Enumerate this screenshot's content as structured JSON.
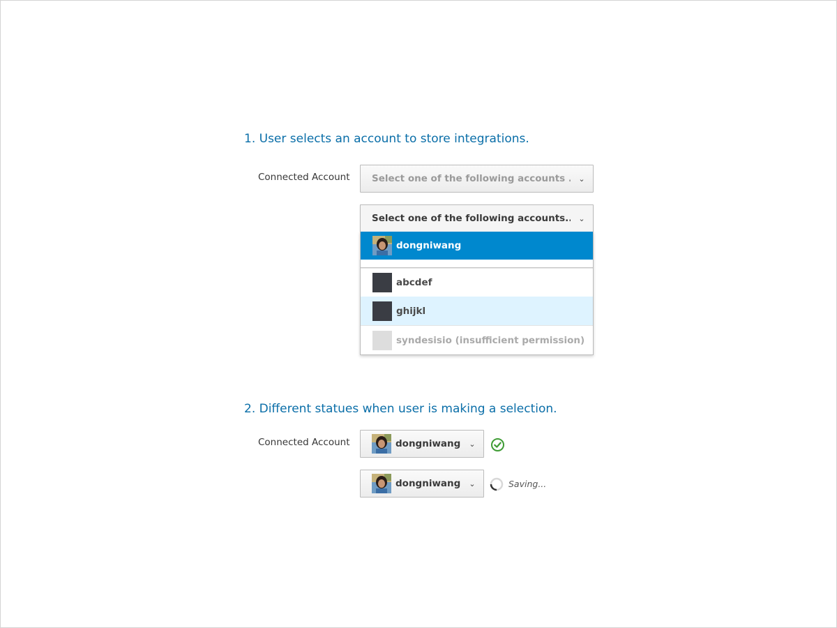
{
  "section1": {
    "heading": "1. User selects an account to store integrations.",
    "label": "Connected Account",
    "closed_select": {
      "placeholder": "Select one of the following accounts ...",
      "caret": "⌄"
    },
    "open_select": {
      "placeholder": "Select one of the following accounts...",
      "caret": "⌄"
    },
    "menu": {
      "items": [
        {
          "name": "dongniwang",
          "state": "selected",
          "avatar": "photo"
        },
        {
          "name": "abcdef",
          "state": "normal",
          "avatar": "dark"
        },
        {
          "name": "ghijkl",
          "state": "hover",
          "avatar": "dark"
        },
        {
          "name": "syndesisio (insufficient permission)",
          "state": "disabled",
          "avatar": "light"
        }
      ]
    }
  },
  "section2": {
    "heading": "2. Different statues when user is making a selection.",
    "label": "Connected Account",
    "saved_select": {
      "value": "dongniwang",
      "caret": "⌄"
    },
    "saving_select": {
      "value": "dongniwang",
      "caret": "⌄"
    },
    "saving_text": "Saving..."
  },
  "colors": {
    "heading": "#0a6ea8",
    "selected_bg": "#0088ce",
    "hover_bg": "#def3ff",
    "success": "#3f9c35"
  },
  "icons": {
    "ok": "check-circle-icon",
    "loading": "spinner-icon",
    "caret": "chevron-down-icon"
  }
}
